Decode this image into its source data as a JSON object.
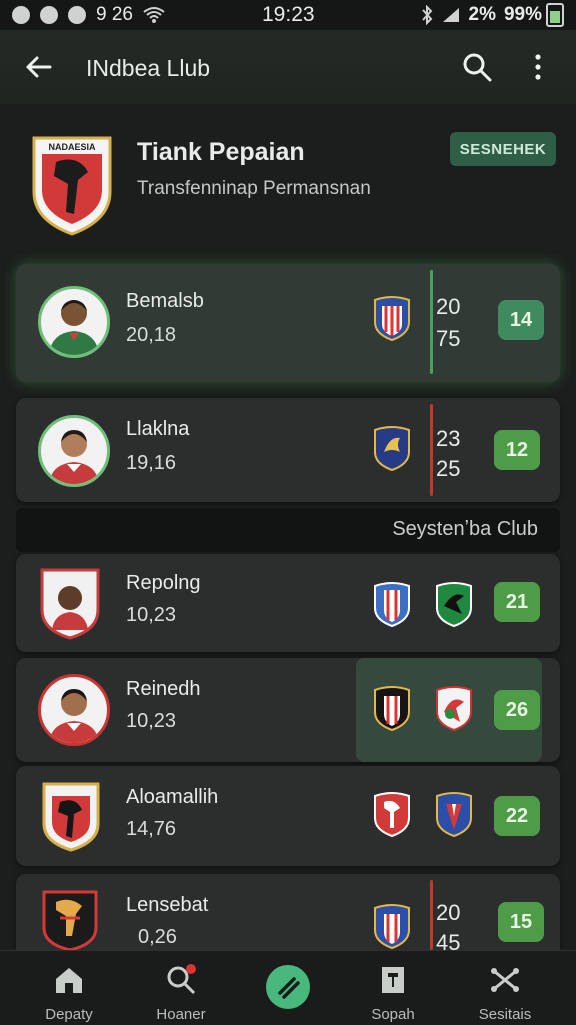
{
  "status_bar": {
    "left_text": "9 26",
    "time": "19:23",
    "signal": "2%",
    "battery": "99%"
  },
  "app_bar": {
    "title": "INdbea Llub",
    "icons": [
      "back-arrow-icon",
      "search-icon",
      "more-vert-icon"
    ]
  },
  "club": {
    "name": "Tiank Pepaian",
    "subtitle": "Transfenninap Permansnan",
    "crest_text": "NADAESIA",
    "follow_label": "SESNEHEK"
  },
  "players": [
    {
      "name": "Bemalsb",
      "value": "20,18",
      "score_top": "20",
      "score_bottom": "75",
      "badge": "14",
      "selected": true
    },
    {
      "name": "Llaklna",
      "value": "19,16",
      "score_top": "23",
      "score_bottom": "25",
      "badge": "12",
      "selected": false
    }
  ],
  "section": {
    "label": "Seystenʼba Club"
  },
  "players2": [
    {
      "name": "Repolng",
      "value": "10,23",
      "badge": "21"
    },
    {
      "name": "Reinedh",
      "value": "10,23",
      "badge": "26"
    },
    {
      "name": "Aloamallih",
      "value": "14,76",
      "badge": "22"
    },
    {
      "name": "Lensebat",
      "value": "0,26",
      "score_top": "20",
      "score_bottom": "45",
      "badge": "15"
    }
  ],
  "colors": {
    "accent": "#49b87c",
    "badge_green": "#4f9c48",
    "bar_red": "#c0392b"
  },
  "bottom_nav": [
    {
      "label": "Depaty",
      "icon": "home-icon"
    },
    {
      "label": "Hoaner",
      "icon": "search-icon"
    },
    {
      "label": "",
      "icon": "center-action-icon"
    },
    {
      "label": "Sopah",
      "icon": "kit-icon"
    },
    {
      "label": "Sesitais",
      "icon": "share-icon"
    }
  ]
}
